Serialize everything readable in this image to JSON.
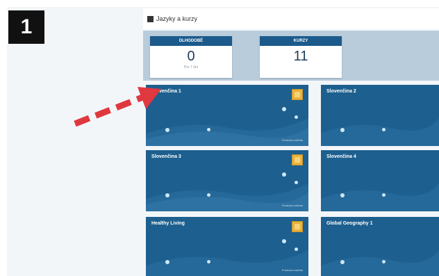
{
  "step_number": "1",
  "header": {
    "title": "Jazyky a kurzy"
  },
  "stats": [
    {
      "label": "DLHODOBÉ",
      "value": "0",
      "sub": "Pre 7 dní"
    },
    {
      "label": "KURZY",
      "value": "11",
      "sub": ""
    }
  ],
  "courses": [
    {
      "title": "Slovenčina 1",
      "footnote": "Posledná aktivita"
    },
    {
      "title": "Slovenčina 2",
      "footnote": ""
    },
    {
      "title": "Slovenčina 3",
      "footnote": "Posledná aktivita"
    },
    {
      "title": "Slovenčina 4",
      "footnote": ""
    },
    {
      "title": "Healthy Living",
      "footnote": "Posledná aktivita"
    },
    {
      "title": "Global Geography 1",
      "footnote": ""
    }
  ],
  "colors": {
    "card_blue": "#1d5f8e",
    "header_blue": "#1c5a8c",
    "panel": "#b9ccdb",
    "badge_gold": "#e9b33a",
    "arrow_red": "#e0383f"
  },
  "icons": {
    "badge": "certificate-icon",
    "arrow": "pointer-arrow"
  }
}
